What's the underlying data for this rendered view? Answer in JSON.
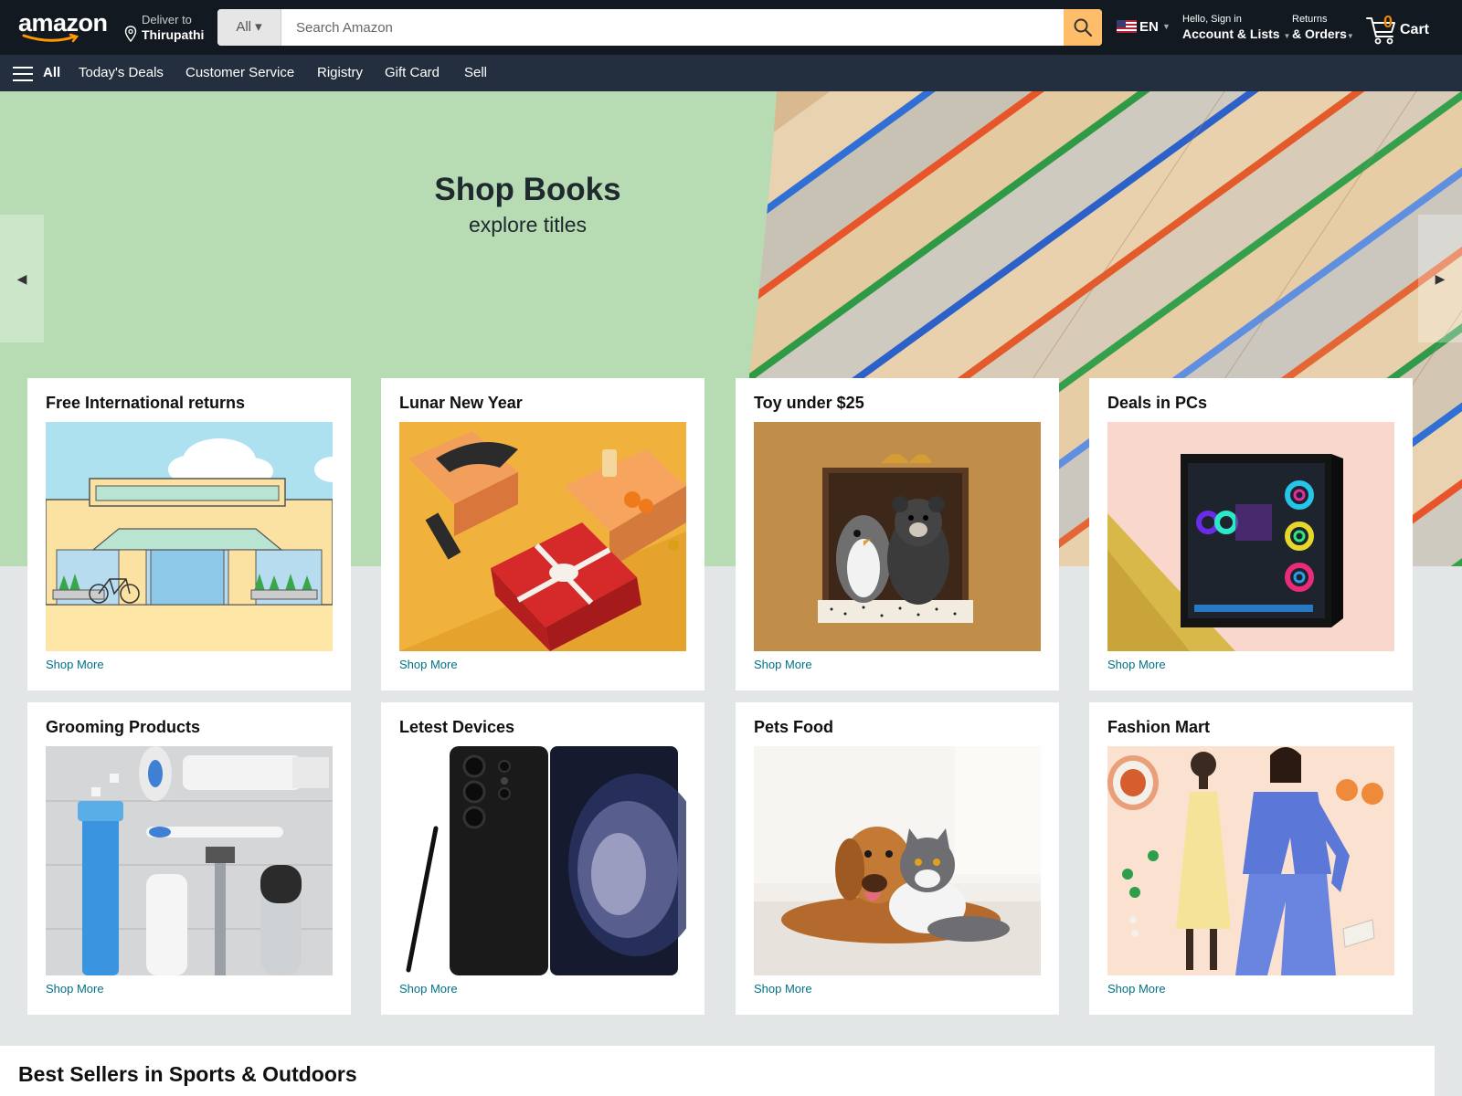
{
  "header": {
    "logo_text": "amazon",
    "deliver_label": "Deliver to",
    "deliver_location": "Thirupathi",
    "search_category": "All",
    "search_placeholder": "Search Amazon",
    "language": "EN",
    "account_line1": "Hello, Sign in",
    "account_line2": "Account & Lists",
    "orders_line1": "Returns",
    "orders_line2": "& Orders",
    "cart_count": "0",
    "cart_label": "Cart"
  },
  "subnav": {
    "all_label": "All",
    "items": [
      "Today's Deals",
      "Customer Service",
      "Rigistry",
      "Gift Card",
      "Sell"
    ]
  },
  "hero": {
    "title": "Shop Books",
    "subtitle": "explore titles"
  },
  "cards": [
    {
      "title": "Free International returns",
      "link": "Shop More"
    },
    {
      "title": "Lunar New Year",
      "link": "Shop More"
    },
    {
      "title": "Toy under $25",
      "link": "Shop More"
    },
    {
      "title": "Deals in PCs",
      "link": "Shop More"
    },
    {
      "title": "Grooming Products",
      "link": "Shop More"
    },
    {
      "title": "Letest Devices",
      "link": "Shop More"
    },
    {
      "title": "Pets Food",
      "link": "Shop More"
    },
    {
      "title": "Fashion Mart",
      "link": "Shop More"
    }
  ],
  "bestsellers": {
    "title": "Best Sellers in Sports & Outdoors"
  },
  "colors": {
    "nav_bg": "#131921",
    "subnav_bg": "#232f3e",
    "search_button": "#febd69",
    "link": "#007185",
    "hero_bg": "#b7dcb4"
  }
}
